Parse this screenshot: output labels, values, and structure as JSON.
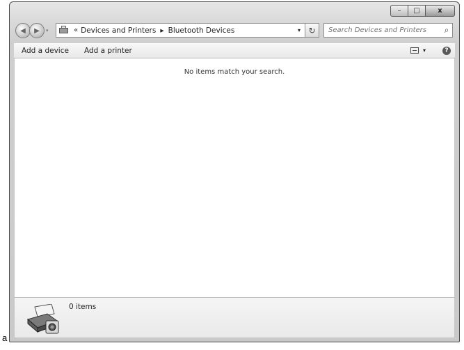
{
  "window": {
    "caption_buttons": {
      "minimize": "–",
      "maximize": "□",
      "close": "x"
    }
  },
  "address": {
    "overflow_chevron": "«",
    "crumbs": [
      "Devices and Printers",
      "Bluetooth Devices"
    ],
    "separator": "▸",
    "dropdown_glyph": "▾",
    "refresh_glyph": "↻",
    "icon": "devices-printers-icon"
  },
  "search": {
    "placeholder": "Search Devices and Printers",
    "icon": "search-icon"
  },
  "command_bar": {
    "add_device": "Add a device",
    "add_printer": "Add a printer",
    "view_dropdown": "▾",
    "help": "?"
  },
  "content": {
    "empty_message": "No items match your search."
  },
  "details": {
    "item_count": "0 items",
    "icon": "devices-printers-icon"
  },
  "figure_label": "a"
}
